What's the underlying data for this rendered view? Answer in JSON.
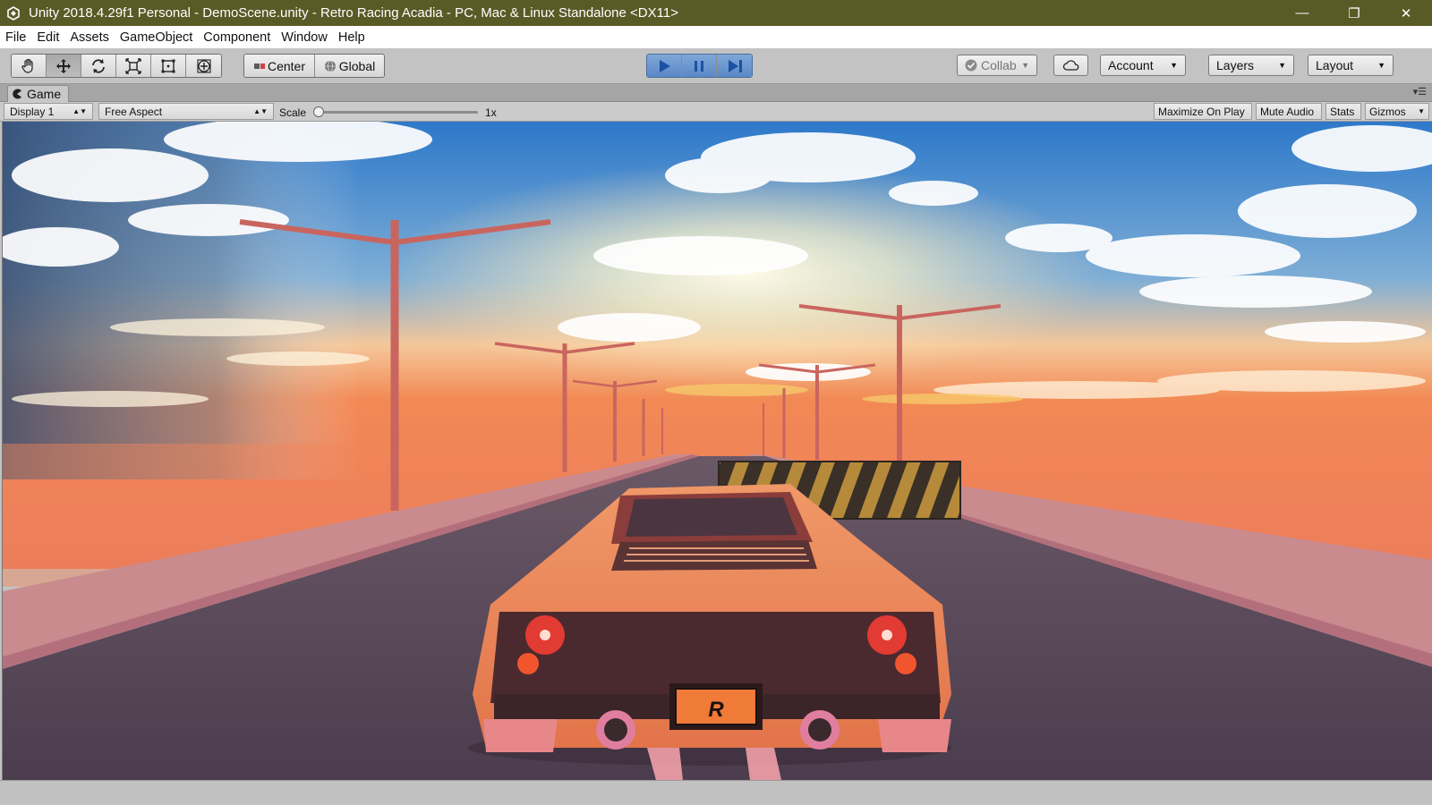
{
  "window": {
    "title": "Unity 2018.4.29f1 Personal - DemoScene.unity - Retro Racing Acadia - PC, Mac & Linux Standalone <DX11>",
    "minimize_glyph": "—",
    "restore_glyph": "❐",
    "close_glyph": "✕"
  },
  "menu": {
    "items": [
      "File",
      "Edit",
      "Assets",
      "GameObject",
      "Component",
      "Window",
      "Help"
    ]
  },
  "toolbar": {
    "tools": [
      "hand-tool",
      "move-tool",
      "rotate-tool",
      "scale-tool",
      "rect-tool",
      "transform-tool"
    ],
    "pivot_label": "Center",
    "space_label": "Global",
    "collab_label": "Collab",
    "account_label": "Account",
    "layers_label": "Layers",
    "layout_label": "Layout"
  },
  "game_view": {
    "tab_label": "Game",
    "display": "Display 1",
    "aspect": "Free Aspect",
    "scale_label": "Scale",
    "scale_value": "1x",
    "scale_fraction": 0.0,
    "maximize_label": "Maximize On Play",
    "mute_label": "Mute Audio",
    "stats_label": "Stats",
    "gizmos_label": "Gizmos"
  },
  "scene": {
    "license_plate": "R",
    "sky_top_color": "#2d78c9",
    "horizon_color": "#f28a55",
    "road_color": "#4b3d4e",
    "car_color": "#e2744a",
    "pole_color": "#c9655f"
  }
}
